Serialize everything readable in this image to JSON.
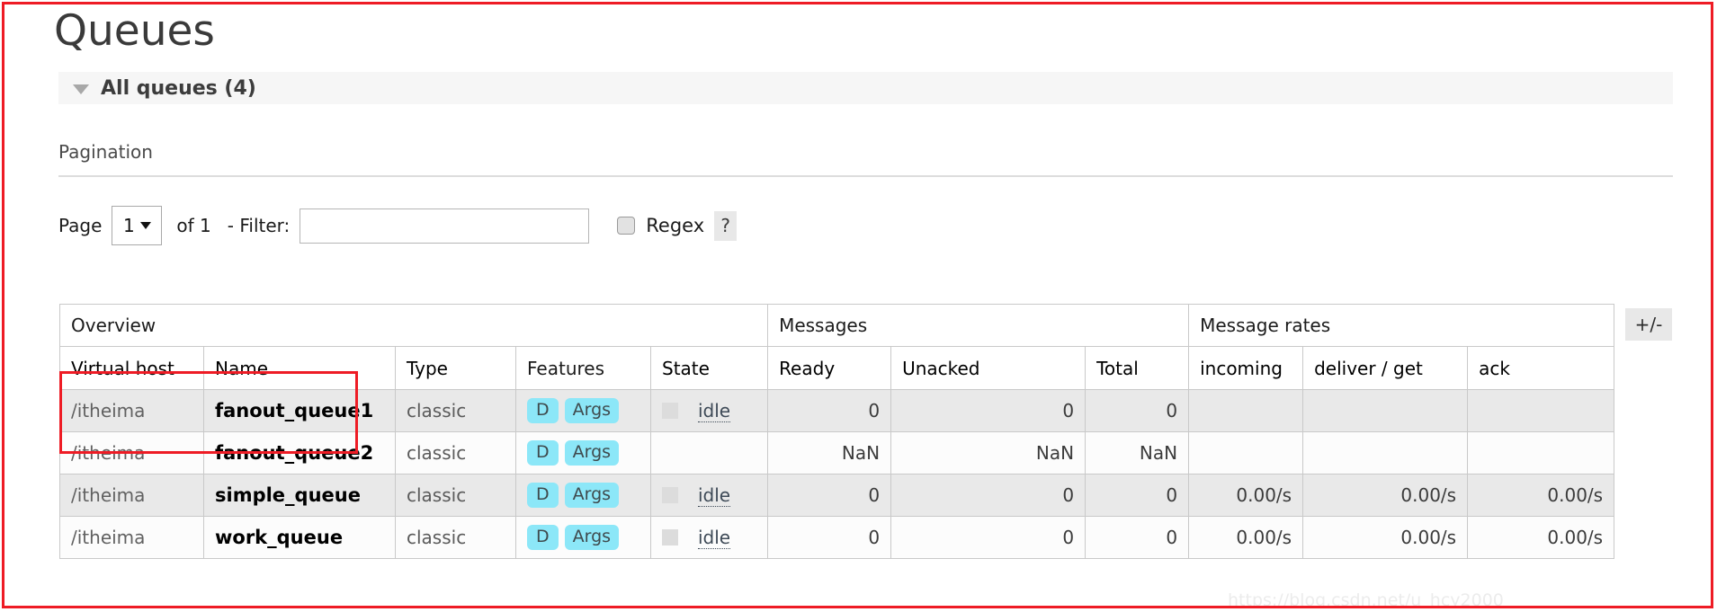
{
  "page": {
    "title": "Queues",
    "section": {
      "label": "All queues (4)",
      "collapse_icon": "triangle-down-icon"
    },
    "watermark": "https://blog.csdn.net/u_hcy2000"
  },
  "pagination": {
    "heading": "Pagination",
    "page_label": "Page",
    "page_value": "1",
    "of_label": "of 1",
    "filter_label": "- Filter:",
    "filter_value": "",
    "filter_placeholder": "",
    "regex_label": "Regex",
    "regex_checked": false,
    "help_label": "?"
  },
  "table": {
    "group_headers": [
      {
        "label": "Overview",
        "span": 5
      },
      {
        "label": "Messages",
        "span": 3
      },
      {
        "label": "Message rates",
        "span": 3
      }
    ],
    "columns": [
      {
        "label": "Virtual host",
        "bold": true,
        "align": "left"
      },
      {
        "label": "Name",
        "bold": true,
        "align": "left"
      },
      {
        "label": "Type",
        "bold": true,
        "align": "left"
      },
      {
        "label": "Features",
        "bold": false,
        "align": "left"
      },
      {
        "label": "State",
        "bold": true,
        "align": "left"
      },
      {
        "label": "Ready",
        "bold": true,
        "align": "left"
      },
      {
        "label": "Unacked",
        "bold": true,
        "align": "left"
      },
      {
        "label": "Total",
        "bold": true,
        "align": "left"
      },
      {
        "label": "incoming",
        "bold": true,
        "align": "left"
      },
      {
        "label": "deliver / get",
        "bold": true,
        "align": "left"
      },
      {
        "label": "ack",
        "bold": true,
        "align": "left"
      }
    ],
    "toggle_columns_label": "+/-",
    "rows": [
      {
        "vhost": "/itheima",
        "name": "fanout_queue1",
        "type": "classic",
        "features": [
          "D",
          "Args"
        ],
        "state": "idle",
        "state_visible": true,
        "ready": "0",
        "unacked": "0",
        "total": "0",
        "incoming": "",
        "deliver_get": "",
        "ack": ""
      },
      {
        "vhost": "/itheima",
        "name": "fanout_queue2",
        "type": "classic",
        "features": [
          "D",
          "Args"
        ],
        "state": "",
        "state_visible": false,
        "ready": "NaN",
        "unacked": "NaN",
        "total": "NaN",
        "incoming": "",
        "deliver_get": "",
        "ack": ""
      },
      {
        "vhost": "/itheima",
        "name": "simple_queue",
        "type": "classic",
        "features": [
          "D",
          "Args"
        ],
        "state": "idle",
        "state_visible": true,
        "ready": "0",
        "unacked": "0",
        "total": "0",
        "incoming": "0.00/s",
        "deliver_get": "0.00/s",
        "ack": "0.00/s"
      },
      {
        "vhost": "/itheima",
        "name": "work_queue",
        "type": "classic",
        "features": [
          "D",
          "Args"
        ],
        "state": "idle",
        "state_visible": true,
        "ready": "0",
        "unacked": "0",
        "total": "0",
        "incoming": "0.00/s",
        "deliver_get": "0.00/s",
        "ack": "0.00/s"
      }
    ]
  },
  "colors": {
    "annotation_red": "#ee1c25",
    "badge_cyan": "#8ce7f8",
    "row_odd": "#e9e9e9",
    "row_even": "#fcfcfc"
  }
}
